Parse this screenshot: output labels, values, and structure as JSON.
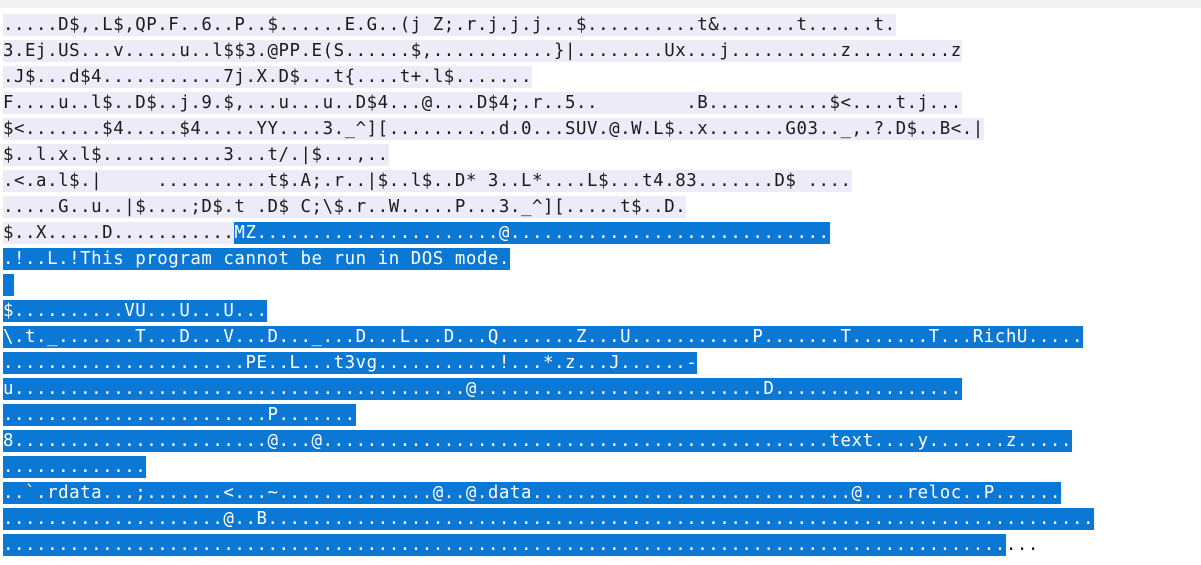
{
  "editor": {
    "lines": [
      [
        {
          "t": ".....D$,.L$,QP.F..6..P..$......E.G..(j Z;.r.j.j.j...$..........t&.......t......t.",
          "s": "unsel"
        }
      ],
      [
        {
          "t": "3.Ej.US...v.....u..l$$3.@PP.E(S......$,...........}|........Ux...j..........z.........z",
          "s": "unsel"
        }
      ],
      [
        {
          "t": ".J$...d$4...........7j.X.D$...t{....t+.l$.......",
          "s": "unsel"
        }
      ],
      [
        {
          "t": "F....u..l$..D$..j.9.$,...u...u..D$4...@....D$4;.r..5..        .B...........$<....t.j...",
          "s": "unsel"
        }
      ],
      [
        {
          "t": "$<.......$4.....$4.....YY....3._^][..........d.0...SUV.@.W.L$..x.......G03.._,.?.D$..B<.|",
          "s": "unsel"
        }
      ],
      [
        {
          "t": "$..l.x.l$...........3...t/.|$...,..",
          "s": "unsel"
        }
      ],
      [
        {
          "t": ".<.a.l$.|     ..........t$.A;.r..|$..l$..D* 3..L*....L$...t4.83.......D$ ....",
          "s": "unsel"
        }
      ],
      [
        {
          "t": ".....G..u..|$....;D$.t .D$ C;\\$.r..W.....P...3._^][.....t$..D.",
          "s": "unsel"
        }
      ],
      [
        {
          "t": "$..X.....D...........",
          "s": "unsel"
        },
        {
          "t": "MZ......................@.............................",
          "s": "sel"
        }
      ],
      [
        {
          "t": ".!..L.!This program cannot be run in DOS mode.",
          "s": "sel"
        }
      ],
      [
        {
          "t": " ",
          "s": "sel"
        }
      ],
      [
        {
          "t": "$..........VU...U...U...",
          "s": "sel"
        }
      ],
      [
        {
          "t": "\\.t._.......T...D...V...D..._...D...L...D...Q.......Z...U...........P.......T.......T...RichU.....",
          "s": "sel"
        }
      ],
      [
        {
          "t": "......................PE..L...t3vg...........!...*.z...J......-",
          "s": "sel"
        }
      ],
      [
        {
          "t": "u.........................................@..........................D.................",
          "s": "sel"
        }
      ],
      [
        {
          "t": "........................P.......",
          "s": "sel"
        }
      ],
      [
        {
          "t": "8.......................@...@..............................................text....y.......z.....",
          "s": "sel"
        }
      ],
      [
        {
          "t": ".............",
          "s": "sel"
        }
      ],
      [
        {
          "t": "..`.rdata...;.......<...~..............@..@.data.............................@....reloc..P......",
          "s": "sel"
        }
      ],
      [
        {
          "t": "....................@..B...........................................................................",
          "s": "sel"
        }
      ],
      [
        {
          "t": "...........................................................................................",
          "s": "sel"
        },
        {
          "t": "...",
          "s": "plain"
        }
      ]
    ]
  }
}
